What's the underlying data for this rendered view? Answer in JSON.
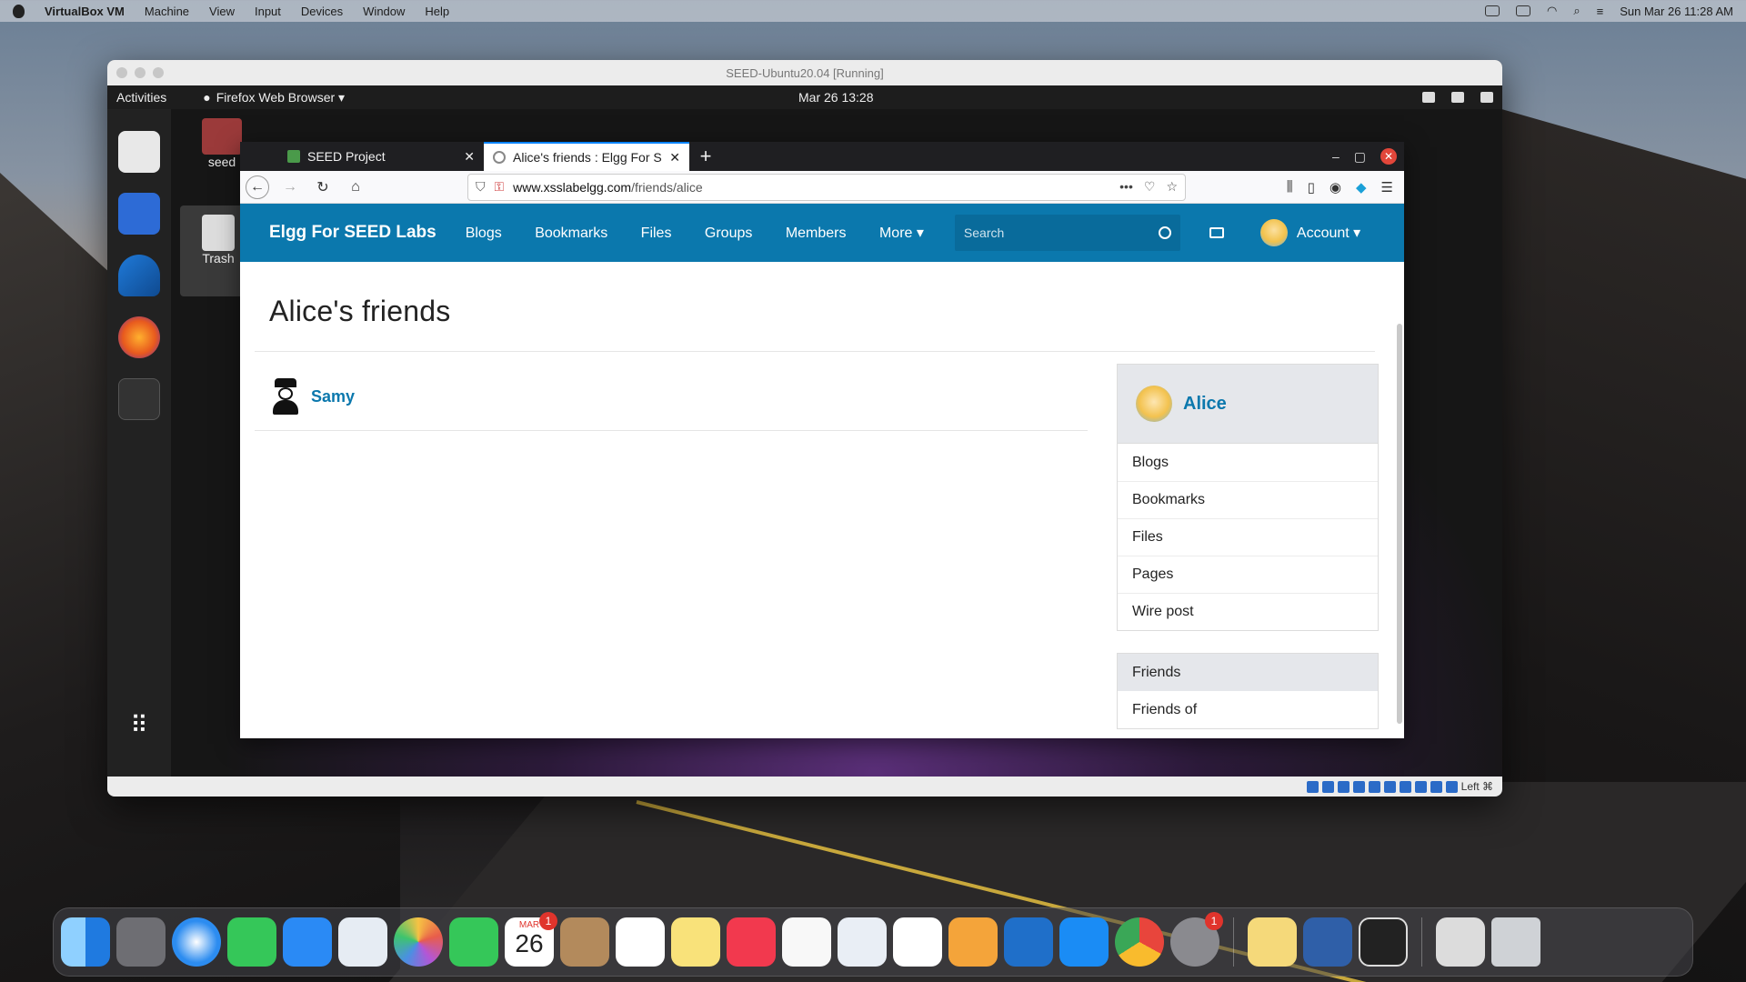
{
  "mac_menu": {
    "app": "VirtualBox VM",
    "items": [
      "Machine",
      "View",
      "Input",
      "Devices",
      "Window",
      "Help"
    ],
    "clock": "Sun Mar 26  11:28 AM"
  },
  "vm": {
    "title": "SEED-Ubuntu20.04 [Running]",
    "status_right": "Left ⌘"
  },
  "ubuntu": {
    "activities": "Activities",
    "app_menu": "Firefox Web Browser ▾",
    "clock": "Mar 26  13:28",
    "desk_home": "seed",
    "desk_trash": "Trash"
  },
  "firefox": {
    "tabs": [
      {
        "label": "SEED Project"
      },
      {
        "label": "Alice's friends : Elgg For SEED Labs"
      }
    ],
    "new_tab": "+",
    "url_host": "www.xsslabelgg.com",
    "url_path": "/friends/alice"
  },
  "elgg": {
    "brand": "Elgg For SEED Labs",
    "nav": [
      "Blogs",
      "Bookmarks",
      "Files",
      "Groups",
      "Members",
      "More ▾"
    ],
    "search_placeholder": "Search",
    "account": "Account ▾",
    "page_title": "Alice's friends",
    "friends": [
      {
        "name": "Samy"
      }
    ],
    "owner": "Alice",
    "owner_links": [
      "Blogs",
      "Bookmarks",
      "Files",
      "Pages",
      "Wire post"
    ],
    "friends_section": [
      "Friends",
      "Friends of"
    ]
  },
  "mac_dock": {
    "calendar_month": "MAR",
    "calendar_day": "26",
    "calendar_badge": "1",
    "settings_badge": "1"
  },
  "colors": {
    "elgg_blue": "#0b78ad",
    "firefox_tab_accent": "#0a84ff"
  }
}
